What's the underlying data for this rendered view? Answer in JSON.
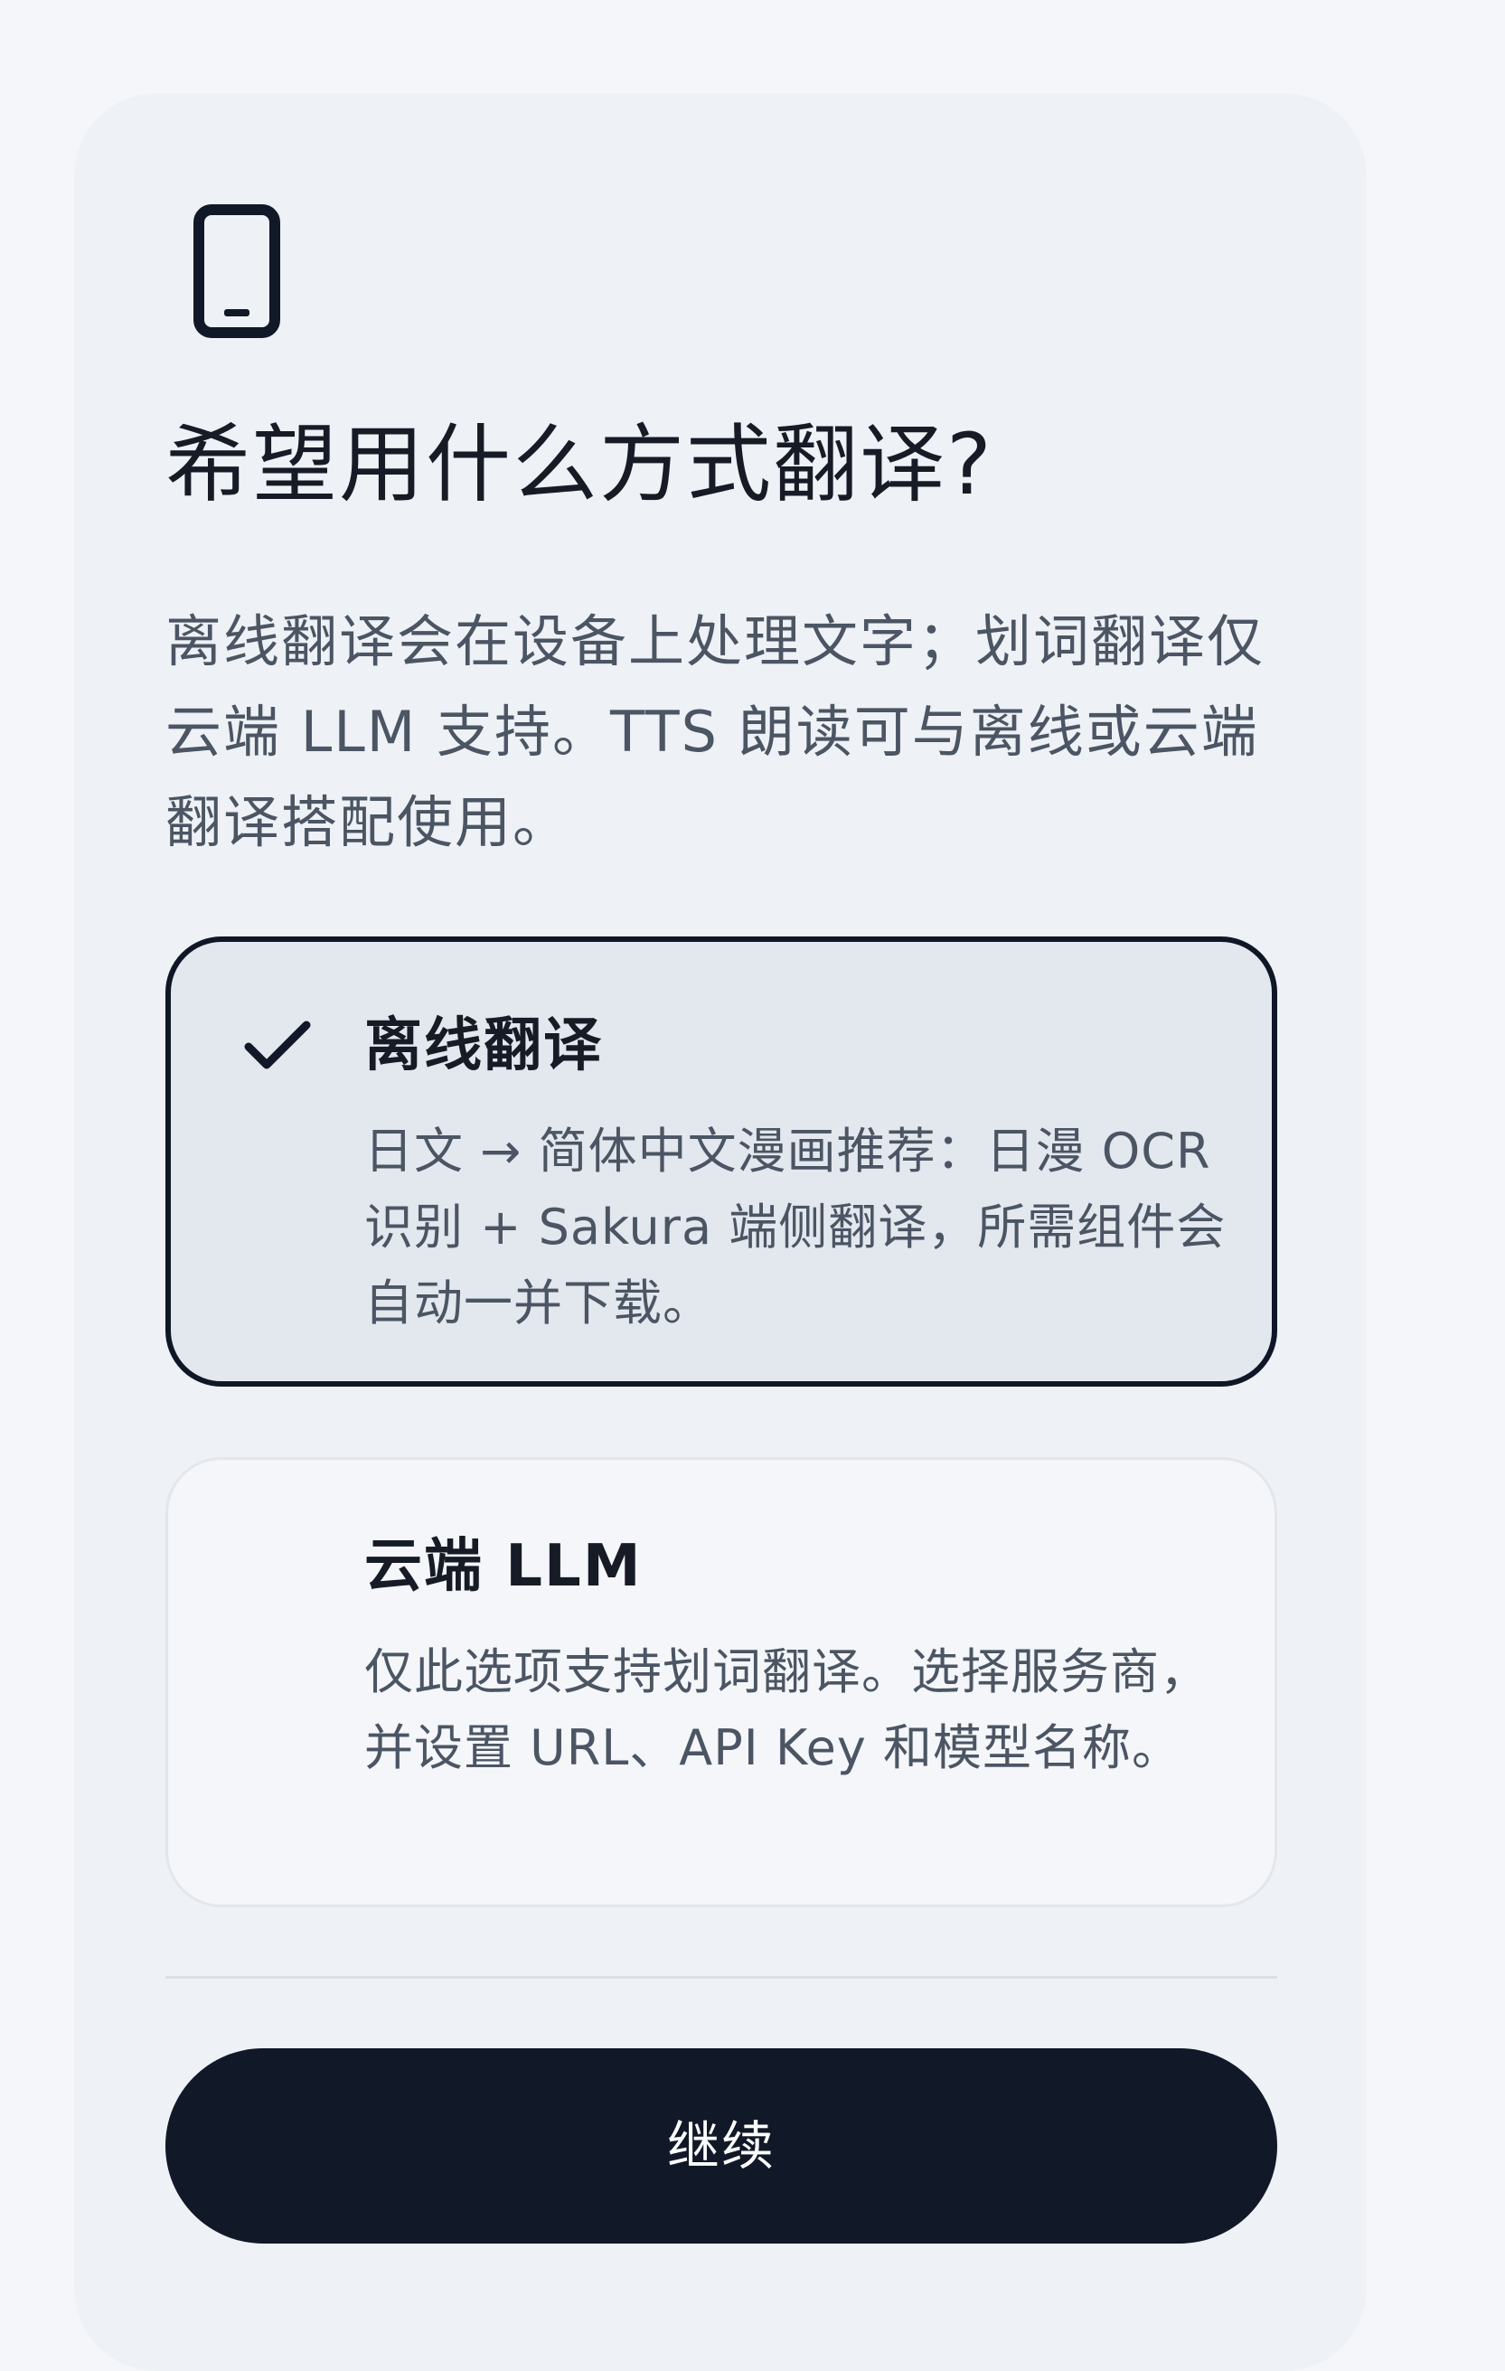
{
  "header": {
    "icon": "smartphone-icon",
    "title": "希望用什么方式翻译?",
    "description": "离线翻译会在设备上处理文字；划词翻译仅云端 LLM 支持。TTS 朗读可与离线或云端翻译搭配使用。"
  },
  "options": [
    {
      "title": "离线翻译",
      "description": "日文 → 简体中文漫画推荐：日漫 OCR 识别 + Sakura 端侧翻译，所需组件会自动一并下载。",
      "selected": true,
      "icon": "checkmark-icon"
    },
    {
      "title": "云端 LLM",
      "description": "仅此选项支持划词翻译。选择服务商，并设置 URL、API Key 和模型名称。",
      "selected": false
    }
  ],
  "actions": {
    "continue_label": "继续"
  },
  "colors": {
    "primary": "#111827",
    "selected_bg": "#e3e7ee",
    "card_bg": "#eef1f5",
    "page_bg": "#f4f6f9"
  }
}
